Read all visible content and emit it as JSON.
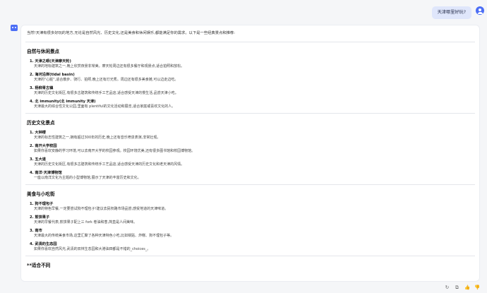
{
  "user_message": "天津哪里好玩?",
  "answer": {
    "intro": "当然!天津有很多好玩的地方,无论是自然风光、历史文化,还是美食和休闲娱乐,都能满足你的需求。以下是一些经典景点和推荐:",
    "sections": [
      {
        "title": "自然与休闲景点",
        "items": [
          {
            "title": "1. 天津之眼(天津摩天轮)",
            "desc": "天津的地标建筑之一,晚上欣赏夜景非常美。摩天轮周边还有很多餐厅和观景点,适合拍照和放松。"
          },
          {
            "title": "2. 海河沿岸(tidal basin)",
            "desc": "天津的\"心脏\",适合散步、骑行、拍照,晚上还有灯光秀。周边还有很多美食摊,可以边走边吃。"
          },
          {
            "title": "3. 杨柳青古镇",
            "desc": "天津的历史文化街区,有很多古建筑和传统手工艺品店,适合感受天津的慢生活,品尝天津小吃。"
          },
          {
            "title": "4. 北 immunity(北 immunity 天津)",
            "desc": "天津最大的综合性文化公园,里面有 plentiful的文化活动和展览,适合家庭或喜欢文化的人。"
          }
        ]
      },
      {
        "title": "历史文化景点",
        "items": [
          {
            "title": "1. 大钟楼",
            "desc": "天津的标志性建筑之一,拥有超过300年的历史,晚上还有音乐喷泉表演,非常壮观。"
          },
          {
            "title": "2. 南开大学校园",
            "desc": "如果你喜欢安静的学习环境,可以去南开大学的校园参观。校园环境优美,还有很多图书馆和校园博物馆。"
          },
          {
            "title": "3. 五大道",
            "desc": "天津的历史文化街区,有很多古建筑和传统手工艺品店,适合感受天津的历史文化和老天津的风情。"
          },
          {
            "title": "4. 南洋·天津博物馆",
            "desc": "一座以南洋文化为主题的小型博物馆,展示了天津的丰富历史和文化。"
          }
        ]
      },
      {
        "title": "美食与小吃街",
        "items": [
          {
            "title": "1. 狗不理包子",
            "desc": "天津的特色早餐,一定要尝试狗不理包子!建议去民权路市场品尝,感受地道的天津味道。"
          },
          {
            "title": "2. 煎饼果子",
            "desc": "天津的早餐代表,煎饼果子配上三 fork 卷油和葱,简直是人间美味。"
          },
          {
            "title": "3. 南市",
            "desc": "天津最大的传统美食市场,这里汇聚了各种天津特色小吃,比如锅贴、炸糕、狗不理包子等。"
          },
          {
            "title": "4. 武清的生态园",
            "desc": "如果你喜欢自然风光,武清的双林生态园和大港油田都是不错的_choices_。"
          }
        ]
      }
    ],
    "trailing_heading": "**适合不同"
  },
  "actions": {
    "copy_icon": "↻",
    "refresh_icon": "⧉",
    "like_icon": "👍",
    "dislike_icon": "👎"
  },
  "colors": {
    "accent": "#4c6ef5",
    "user_bubble": "#dfe6fb"
  }
}
